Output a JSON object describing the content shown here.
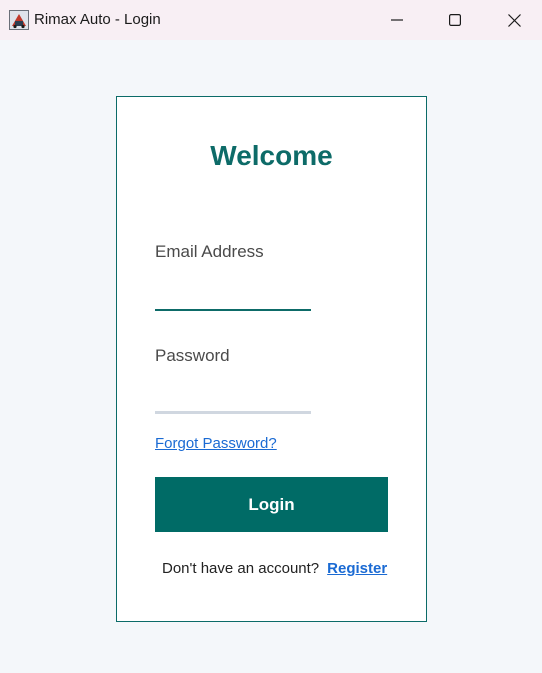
{
  "window": {
    "title": "Rimax Auto - Login",
    "controls": [
      "minimize",
      "maximize",
      "close"
    ]
  },
  "login_card": {
    "heading": "Welcome",
    "email": {
      "label": "Email Address",
      "value": "",
      "placeholder": ""
    },
    "password": {
      "label": "Password",
      "value": "",
      "placeholder": ""
    },
    "forgot_password_link": "Forgot Password?",
    "login_button": "Login",
    "register_prompt": "Don't have an account?",
    "register_link": "Register"
  },
  "colors": {
    "brand": "#006b66",
    "link": "#1a6ad3",
    "background": "#f4f7fa",
    "titlebar": "#f8eff4"
  },
  "icons": {
    "app": "app-logo-icon",
    "minimize": "minimize-icon",
    "maximize": "maximize-icon",
    "close": "close-icon"
  }
}
